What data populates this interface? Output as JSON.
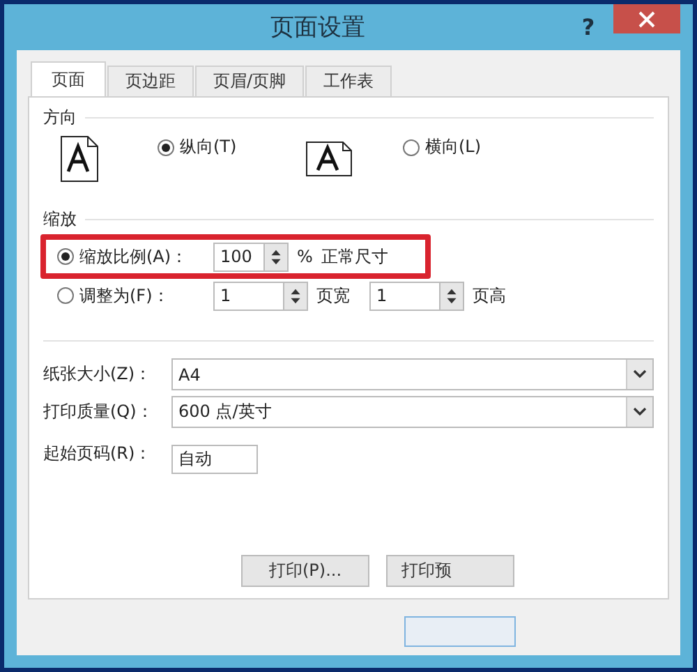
{
  "window": {
    "title": "页面设置",
    "help": "?"
  },
  "tabs": [
    {
      "label": "页面",
      "selected": true
    },
    {
      "label": "页边距",
      "selected": false
    },
    {
      "label": "页眉/页脚",
      "selected": false
    },
    {
      "label": "工作表",
      "selected": false
    }
  ],
  "orientation": {
    "heading": "方向",
    "options": [
      {
        "label": "纵向(T)",
        "kind": "portrait",
        "selected": true
      },
      {
        "label": "横向(L)",
        "kind": "landscape",
        "selected": false
      }
    ]
  },
  "scaling": {
    "heading": "缩放",
    "highlighted": true,
    "adjust": {
      "label": "缩放比例(A)：",
      "selected": true,
      "value": "100",
      "unit": "%",
      "note": "正常尺寸"
    },
    "fit": {
      "label": "调整为(F)：",
      "selected": false,
      "wide_value": "1",
      "wide_label": "页宽",
      "tall_value": "1",
      "tall_label": "页高"
    }
  },
  "fields": [
    {
      "label": "纸张大小(Z)：",
      "kind": "select",
      "value": "A4"
    },
    {
      "label": "打印质量(Q)：",
      "kind": "select",
      "value": "600 点/英寸"
    },
    {
      "label": "起始页码(R)：",
      "kind": "text",
      "value": "自动"
    }
  ],
  "panel_buttons": [
    "打印(P)...",
    "打印预"
  ]
}
